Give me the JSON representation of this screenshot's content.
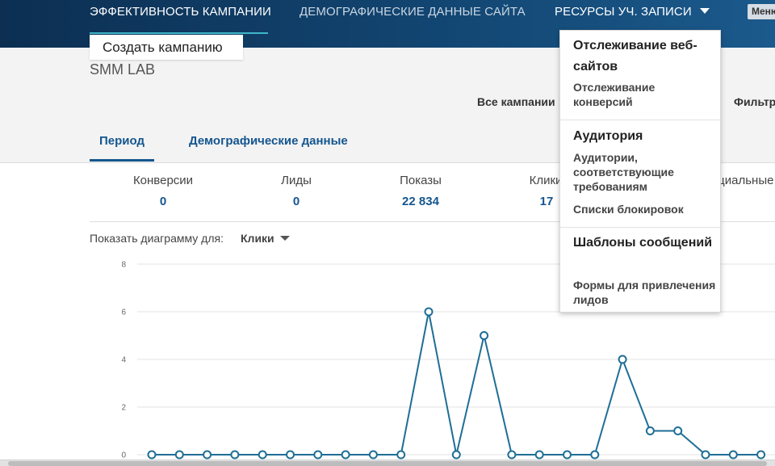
{
  "top_nav": {
    "items": [
      {
        "label": "ЭФФЕКТИВНОСТЬ КАМПАНИИ",
        "active": true
      },
      {
        "label": "ДЕМОГРАФИЧЕСКИЕ ДАННЫЕ САЙТА",
        "active": false
      },
      {
        "label": "РЕСУРСЫ УЧ. ЗАПИСИ",
        "active": false
      }
    ],
    "menu_label": "Меню"
  },
  "create_campaign_label": "Создать кампанию",
  "account_name": "SMM LAB",
  "campaign_filter_label": "Все кампании",
  "filter_label": "Фильтр",
  "tabs": [
    {
      "label": "Период",
      "active": true
    },
    {
      "label": "Демографические данные",
      "active": false
    }
  ],
  "stats": [
    {
      "label": "Конверсии",
      "value": "0"
    },
    {
      "label": "Лиды",
      "value": "0"
    },
    {
      "label": "Показы",
      "value": "22 834"
    },
    {
      "label": "Клики",
      "value": "17"
    },
    {
      "label": "Социальные действия",
      "value": ""
    }
  ],
  "chart_controls": {
    "show_label": "Показать диаграмму для:",
    "metric": "Клики"
  },
  "dropdown": {
    "sections": [
      {
        "title": "Отслеживание веб-сайтов",
        "items": [
          "Отслеживание конверсий"
        ]
      },
      {
        "title": "Аудитория",
        "items": [
          "Аудитории, соответствующие требованиям",
          "Списки блокировок"
        ]
      },
      {
        "title": "Шаблоны сообщений",
        "items": [
          "Формы для привлечения лидов"
        ]
      }
    ]
  },
  "colors": {
    "accent": "#14568f",
    "line": "#1f6e96",
    "header_dark": "#0c2f52"
  },
  "chart_data": {
    "type": "line",
    "title": "",
    "xlabel": "",
    "ylabel": "",
    "ylim": [
      0,
      8
    ],
    "yticks": [
      "0",
      "2",
      "4",
      "6",
      "8"
    ],
    "grid": true,
    "series": [
      {
        "values": [
          0,
          0,
          0,
          0,
          0,
          0,
          0,
          0,
          0,
          0,
          6,
          0,
          5,
          0,
          0,
          0,
          0,
          4,
          1,
          1,
          0,
          0,
          0
        ]
      }
    ]
  }
}
